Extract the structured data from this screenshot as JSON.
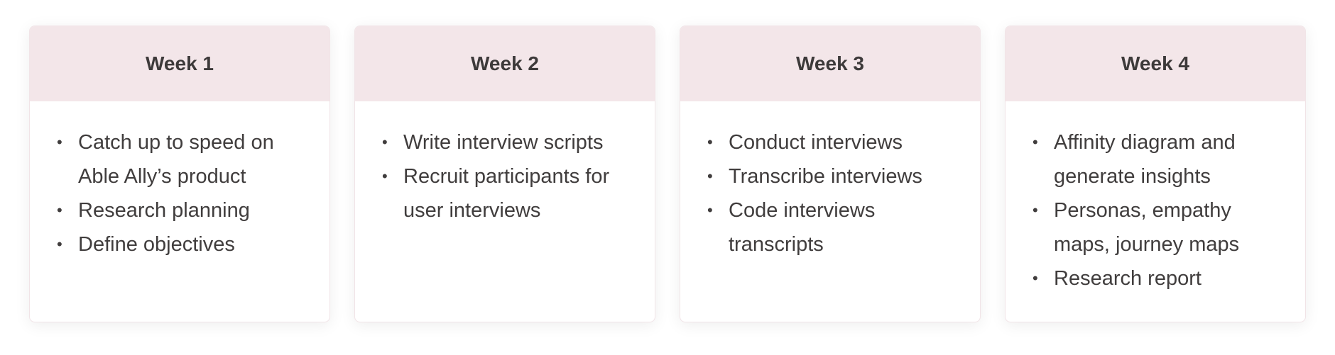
{
  "weeks": [
    {
      "title": "Week 1",
      "items": [
        "Catch up to speed on Able Ally’s product",
        "Research planning",
        "Define objectives"
      ]
    },
    {
      "title": "Week 2",
      "items": [
        "Write interview scripts",
        "Recruit participants for user interviews"
      ]
    },
    {
      "title": "Week 3",
      "items": [
        "Conduct interviews",
        "Transcribe interviews",
        "Code interviews transcripts"
      ]
    },
    {
      "title": "Week 4",
      "items": [
        "Affinity diagram and generate insights",
        "Personas, empathy maps, journey maps",
        "Research report"
      ]
    }
  ],
  "colors": {
    "header_bg": "#f3e6e9",
    "text": "#403d3d"
  }
}
